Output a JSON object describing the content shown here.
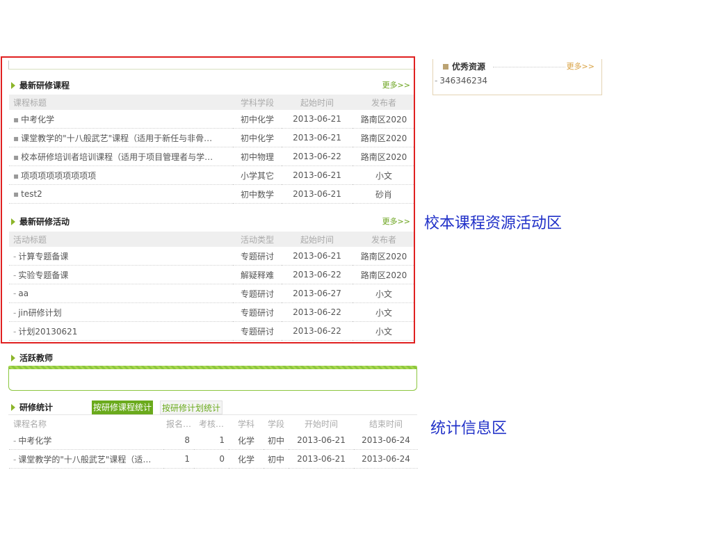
{
  "courses": {
    "title": "最新研修课程",
    "more": "更多>>",
    "columns": [
      "课程标题",
      "学科学段",
      "起始时间",
      "发布者"
    ],
    "rows": [
      [
        "中考化学",
        "初中化学",
        "2013-06-21",
        "路南区2020"
      ],
      [
        "课堂教学的\"十八般武艺\"课程（适用于新任与非骨…",
        "初中化学",
        "2013-06-21",
        "路南区2020"
      ],
      [
        "校本研修培训者培训课程（适用于项目管理者与学…",
        "初中物理",
        "2013-06-22",
        "路南区2020"
      ],
      [
        "项项项项项项项项项",
        "小学其它",
        "2013-06-21",
        "小文"
      ],
      [
        "test2",
        "初中数学",
        "2013-06-21",
        "砂肖"
      ]
    ]
  },
  "activities": {
    "title": "最新研修活动",
    "more": "更多>>",
    "columns": [
      "活动标题",
      "活动类型",
      "起始时间",
      "发布者"
    ],
    "rows": [
      [
        "计算专题备课",
        "专题研讨",
        "2013-06-21",
        "路南区2020"
      ],
      [
        "实验专题备课",
        "解疑释难",
        "2013-06-22",
        "路南区2020"
      ],
      [
        "aa",
        "专题研讨",
        "2013-06-27",
        "小文"
      ],
      [
        "jin研修计划",
        "专题研讨",
        "2013-06-22",
        "小文"
      ],
      [
        "计划20130621",
        "专题研讨",
        "2013-06-22",
        "小文"
      ]
    ]
  },
  "resources": {
    "title": "优秀资源",
    "more": "更多>>",
    "items": [
      "346346234"
    ]
  },
  "teachers": {
    "title": "活跃教师"
  },
  "stats": {
    "title": "研修统计",
    "tabs": [
      "按研修课程统计",
      "按研修计划统计"
    ],
    "columns": [
      "课程名称",
      "报名…",
      "考核…",
      "学科",
      "学段",
      "开始时间",
      "结束时间"
    ],
    "rows": [
      [
        "中考化学",
        "8",
        "1",
        "化学",
        "初中",
        "2013-06-21",
        "2013-06-24"
      ],
      [
        "课堂教学的\"十八般武艺\"课程（适…",
        "1",
        "0",
        "化学",
        "初中",
        "2013-06-21",
        "2013-06-24"
      ]
    ]
  },
  "annotations": {
    "activity_area": "校本课程资源活动区",
    "stats_area": "统计信息区"
  },
  "colors": {
    "highlight_border": "#e02020",
    "accent_green": "#6aaa1c",
    "annotation_blue": "#2030c8"
  }
}
